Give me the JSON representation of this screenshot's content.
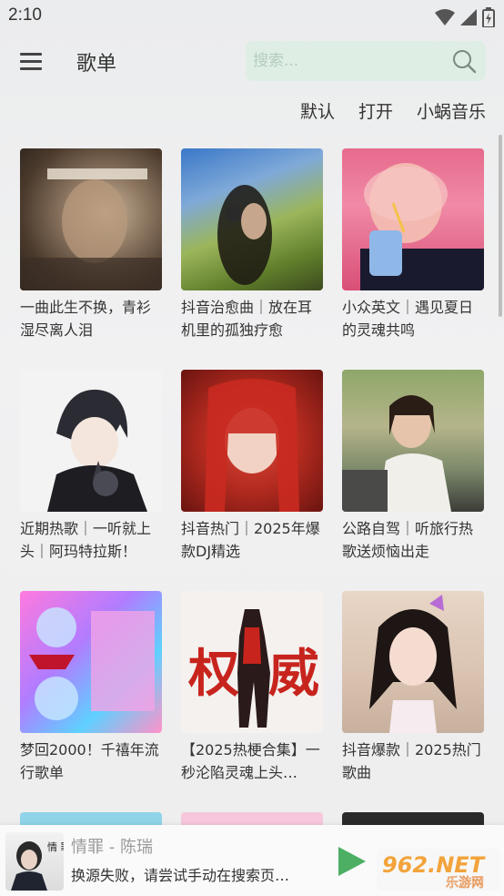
{
  "status_bar": {
    "time": "2:10"
  },
  "header": {
    "title": "歌单",
    "search_placeholder": "搜索..."
  },
  "filters": [
    {
      "label": "默认"
    },
    {
      "label": "打开"
    },
    {
      "label": "小蜗音乐"
    }
  ],
  "playlists": [
    {
      "title": "一曲此生不换，青衫湿尽离人泪",
      "cover": "warrior-portrait"
    },
    {
      "title": "抖音治愈曲｜放在耳机里的孤独疗愈",
      "cover": "girl-with-headphones"
    },
    {
      "title": "小众英文｜遇见夏日的灵魂共鸣",
      "cover": "girl-with-drink"
    },
    {
      "title": "近期热歌｜一听就上头｜阿玛特拉斯！",
      "cover": "anime-boy-with-cat"
    },
    {
      "title": "抖音热门｜2025年爆款DJ精选",
      "cover": "red-hair-girl"
    },
    {
      "title": "公路自驾｜听旅行热歌送烦恼出走",
      "cover": "girl-by-car"
    },
    {
      "title": "梦回2000！千禧年流行歌单",
      "cover": "y2k-collage"
    },
    {
      "title": "【2025热梗合集】一秒沦陷灵魂上头…",
      "cover": "hero-figure"
    },
    {
      "title": "抖音爆款｜2025热门歌曲",
      "cover": "girl-with-bows"
    }
  ],
  "player": {
    "song": "情罪 - 陈瑞",
    "status": "换源失败，请尝试手动在搜索页…",
    "cover_text": "情 罪"
  },
  "watermark": {
    "text": "962.NET",
    "sub": "乐游网"
  },
  "colors": {
    "accent_green": "#4caf63",
    "search_bg": "#dfeee4"
  }
}
